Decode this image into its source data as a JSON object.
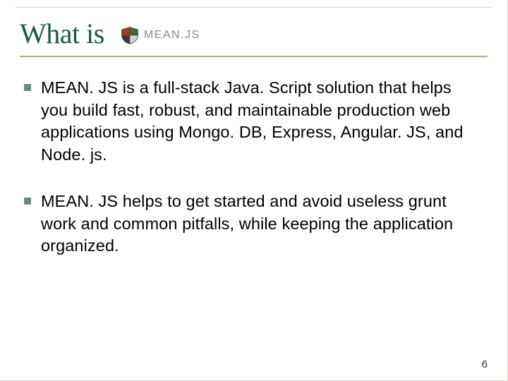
{
  "title": "What is",
  "logo": {
    "text": "MEAN.JS"
  },
  "bullets": [
    "MEAN. JS is a full-stack Java. Script solution that helps you build fast, robust, and maintainable production web applications using Mongo. DB, Express, Angular. JS, and Node. js.",
    "MEAN. JS helps to get started and avoid useless grunt work and common pitfalls, while keeping the application organized."
  ],
  "page_number": "6"
}
